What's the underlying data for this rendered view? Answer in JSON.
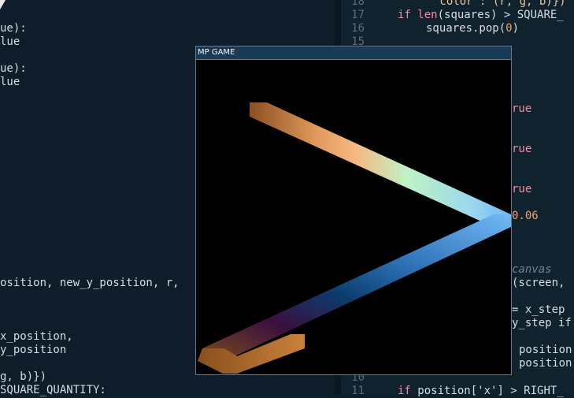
{
  "window": {
    "title": "MP GAME"
  },
  "left_editor": {
    "lines": [
      "ue):",
      "lue",
      "ue):",
      "lue",
      "osition, new_y_position, r,",
      "x_position,",
      "y_position",
      "g, b)})",
      "SQUARE_QUANTITY:"
    ]
  },
  "right_editor": {
    "line_numbers": [
      "18",
      "17",
      "16",
      "15",
      "10",
      "11"
    ],
    "code": {
      "l18": "'color': (r, g, b)})",
      "l17_kw": "if",
      "l17_fn": "len",
      "l17_rest": "(squares) > SQUARE_",
      "l16_a": "squares.pop(",
      "l16_num": "0",
      "l16_b": ")",
      "l11_kw": "if",
      "l11_rest": "position['x'] > RIGHT_"
    },
    "fragments": {
      "true1": "rue",
      "true2": "rue",
      "true3": "rue",
      "num": "0.06",
      "comment": "canvas",
      "screen": "(screen,",
      "xstep": "= x_step",
      "ystep": "y_step if",
      "pos1": "position",
      "pos2": "position"
    }
  },
  "colors": {
    "editor_bg": "#0e1d29",
    "keyword": "#f28b9b",
    "number": "#f2a06a",
    "comment": "#6e8493",
    "game_titlebar": "#1b3b54"
  }
}
